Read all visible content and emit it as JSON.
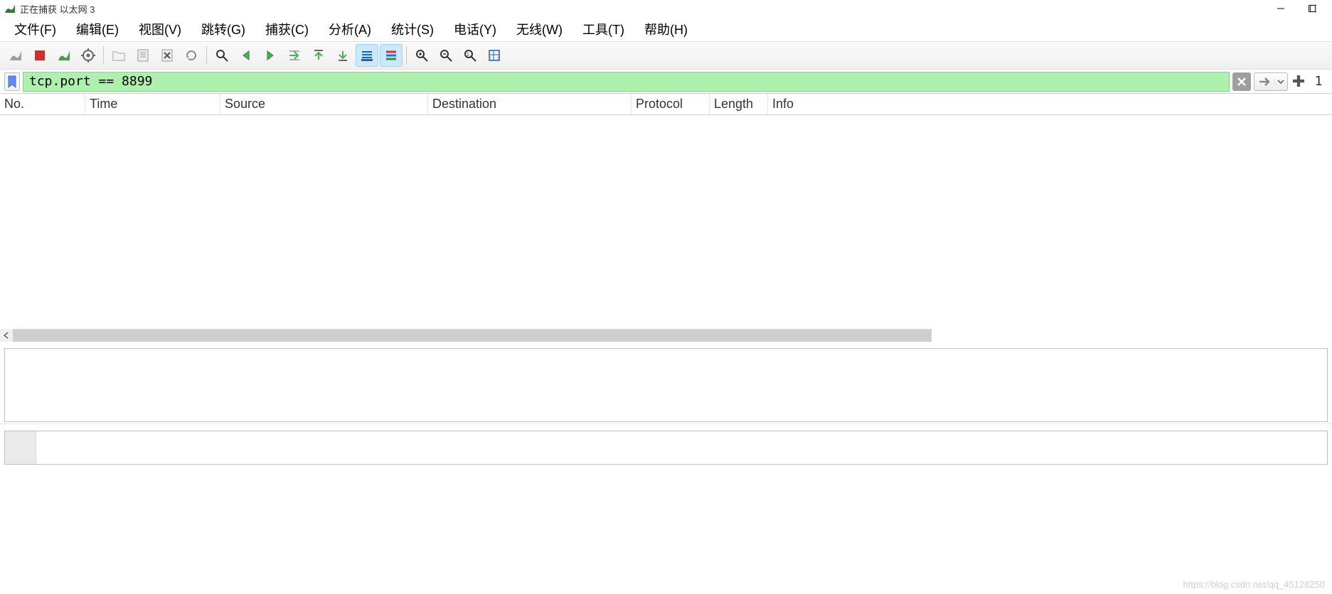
{
  "window": {
    "title": "正在捕获 以太网 3"
  },
  "menu": {
    "items": [
      {
        "label": "文件(F)"
      },
      {
        "label": "编辑(E)"
      },
      {
        "label": "视图(V)"
      },
      {
        "label": "跳转(G)"
      },
      {
        "label": "捕获(C)"
      },
      {
        "label": "分析(A)"
      },
      {
        "label": "统计(S)"
      },
      {
        "label": "电话(Y)"
      },
      {
        "label": "无线(W)"
      },
      {
        "label": "工具(T)"
      },
      {
        "label": "帮助(H)"
      }
    ]
  },
  "toolbar": {
    "icons": [
      "shark-fin",
      "stop",
      "restart",
      "options",
      "SEP",
      "open",
      "save",
      "close",
      "reload",
      "SEP",
      "find",
      "go-back",
      "go-forward",
      "go-jump",
      "go-first",
      "go-last",
      "auto-scroll",
      "colorize",
      "SEP",
      "zoom-in",
      "zoom-out",
      "zoom-reset",
      "resize-columns"
    ]
  },
  "filter": {
    "value": "tcp.port == 8899",
    "count": "1"
  },
  "columns": {
    "no": "No.",
    "time": "Time",
    "source": "Source",
    "destination": "Destination",
    "protocol": "Protocol",
    "length": "Length",
    "info": "Info"
  },
  "watermark": "https://blog.csdn.net/qq_45128250"
}
